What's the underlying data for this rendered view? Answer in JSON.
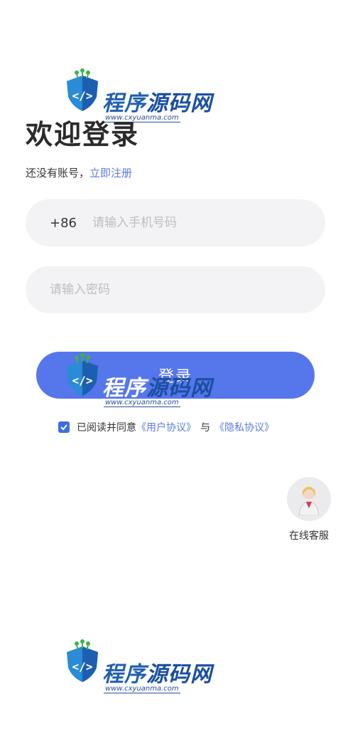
{
  "header": {
    "title": "欢迎登录",
    "register_prompt": "还没有账号，",
    "register_link": "立即注册"
  },
  "phone_field": {
    "prefix": "+86",
    "placeholder": "请输入手机号码",
    "value": ""
  },
  "password_field": {
    "placeholder": "请输入密码",
    "value": ""
  },
  "login_button": {
    "label": "登录"
  },
  "agreement": {
    "checked": true,
    "text": "已阅读并同意",
    "user_agreement": "《用户协议》",
    "separator": "与",
    "privacy_policy": "《隐私协议》"
  },
  "customer_service": {
    "label": "在线客服",
    "icon": "avatar-agent-icon"
  },
  "watermark": {
    "brand_part1": "程序",
    "brand_part2": "源码网",
    "url": "www.cxyuanma.com"
  },
  "colors": {
    "accent": "#5676ec",
    "link": "#5b7be6",
    "field_bg": "#f3f3f5",
    "checkbox": "#3d6fe0"
  }
}
